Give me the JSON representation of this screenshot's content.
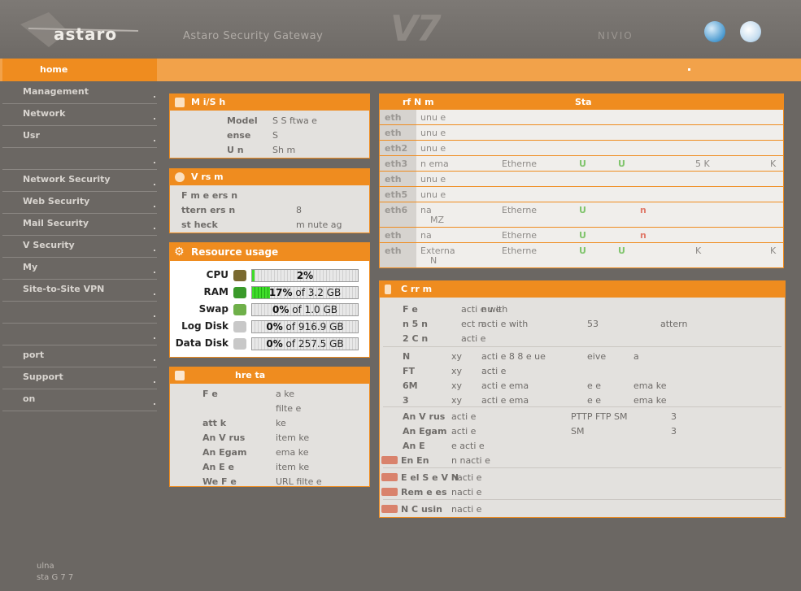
{
  "header": {
    "logo": "astaro",
    "product": "Astaro Security Gateway",
    "version": "V7",
    "user": "NIVIO",
    "icons": [
      "globe-icon",
      "help-icon"
    ]
  },
  "tab": {
    "label": "home"
  },
  "sidebar": {
    "items": [
      {
        "label": "Management"
      },
      {
        "label": "Network"
      },
      {
        "label": "Usr"
      },
      {
        "label": ""
      },
      {
        "label": "Network Security"
      },
      {
        "label": "Web Security"
      },
      {
        "label": "Mail Security"
      },
      {
        "label": "V Security"
      },
      {
        "label": "My"
      },
      {
        "label": "Site-to-Site VPN"
      },
      {
        "label": ""
      },
      {
        "label": ""
      },
      {
        "label": "port"
      },
      {
        "label": "Support"
      },
      {
        "label": "on"
      }
    ],
    "footer_line1": "ulna",
    "footer_line2": "sta G 7 7"
  },
  "system_panel": {
    "title": "M  i/S    h",
    "rows": [
      {
        "label": "Model",
        "value": "S S ftwa e"
      },
      {
        "label": "ense",
        "value": "S"
      },
      {
        "label": "U  n",
        "value": "Sh  m"
      }
    ]
  },
  "version_panel": {
    "title": "V  rs          m",
    "rows": [
      {
        "label": "F m      e  ers  n",
        "value": ""
      },
      {
        "label": "ttern  ers  n",
        "value": "8"
      },
      {
        "label": "st  heck",
        "value": "m nute  ag"
      }
    ]
  },
  "resource_panel": {
    "title": "Resource usage",
    "rows": [
      {
        "label": "CPU",
        "icon": "cpu-icon",
        "value": "2%",
        "extra": "",
        "fraction": 0.02
      },
      {
        "label": "RAM",
        "icon": "ram-icon",
        "value": "17%",
        "extra": "of 3.2 GB",
        "fraction": 0.17
      },
      {
        "label": "Swap",
        "icon": "swap-icon",
        "value": "0%",
        "extra": "of 1.0 GB",
        "fraction": 0.0
      },
      {
        "label": "Log Disk",
        "icon": "disk-icon",
        "value": "0%",
        "extra": "of 916.9 GB",
        "fraction": 0.0
      },
      {
        "label": "Data Disk",
        "icon": "disk-icon",
        "value": "0%",
        "extra": "of 257.5 GB",
        "fraction": 0.0
      }
    ]
  },
  "threat_panel": {
    "title": "hre     ta",
    "rows": [
      {
        "label": "F e",
        "value": "a  ke"
      },
      {
        "label": "",
        "value": "filte e"
      },
      {
        "label": "att  k",
        "value": "ke"
      },
      {
        "label": "An  V rus",
        "value": "item       ke"
      },
      {
        "label": "An  Egam",
        "value": "ema        ke"
      },
      {
        "label": "An  E      e",
        "value": "item       ke"
      },
      {
        "label": "We  F  e",
        "value": "URL  filte e"
      }
    ]
  },
  "interfaces": {
    "headers": [
      "rf  N  m",
      "Sta"
    ],
    "rows": [
      {
        "id": "eth",
        "name": "unu e",
        "type": "",
        "s1": "",
        "s2": "",
        "speed": "",
        "extra": ""
      },
      {
        "id": "eth",
        "name": "unu e",
        "type": "",
        "s1": "",
        "s2": "",
        "speed": "",
        "extra": ""
      },
      {
        "id": "eth2",
        "name": "unu e",
        "type": "",
        "s1": "",
        "s2": "",
        "speed": "",
        "extra": ""
      },
      {
        "id": "eth3",
        "name": "n ema",
        "type": "Etherne",
        "s1": "U",
        "s2": "U",
        "speed": "5 K",
        "extra": "K"
      },
      {
        "id": "eth",
        "name": "unu e",
        "type": "",
        "s1": "",
        "s2": "",
        "speed": "",
        "extra": ""
      },
      {
        "id": "eth5",
        "name": "unu e",
        "type": "",
        "s1": "",
        "s2": "",
        "speed": "",
        "extra": ""
      },
      {
        "id": "eth6",
        "name": "na",
        "name2": "MZ",
        "type": "Etherne",
        "s1": "U",
        "s2": "n",
        "speed": "",
        "extra": ""
      },
      {
        "id": "eth",
        "name": "na",
        "type": "Etherne",
        "s1": "U",
        "s2": "n",
        "speed": "",
        "extra": ""
      },
      {
        "id": "eth",
        "name": "Externa",
        "name2": "N",
        "type": "Etherne",
        "s1": "U",
        "s2": "U",
        "speed": "K",
        "extra": "K"
      }
    ]
  },
  "config_panel": {
    "title": "C  rr          m",
    "rows": [
      {
        "a": "F  e",
        "b": "acti e with",
        "c": "nu e",
        "d": ""
      },
      {
        "a": "n   5   n",
        "b": "ect  n",
        "c": "acti e with",
        "d": "53",
        "e": "attern"
      },
      {
        "a": "2  C  n",
        "b": "acti e",
        "c": "",
        "d": ""
      },
      {
        "a": "N",
        "b": "xy",
        "c": "acti e  8 8  e  ue",
        "d": "eive",
        "e": "a"
      },
      {
        "a": "FT",
        "b": "xy",
        "c": "acti e",
        "d": ""
      },
      {
        "a": "6M",
        "b": "xy",
        "c": "acti e   ema",
        "d": "e   e",
        "e": "ema   ke"
      },
      {
        "a": "3",
        "b": "xy",
        "c": "acti e   ema",
        "d": "e   e",
        "e": "ema   ke"
      },
      {
        "a": "An  V rus",
        "b": "acti e",
        "c": "PTTP FTP SM",
        "d": "3"
      },
      {
        "a": "An  Egam",
        "b": "acti e",
        "c": "SM",
        "d": "3"
      },
      {
        "a": "An  E",
        "b": "e   acti e",
        "c": "",
        "d": ""
      },
      {
        "a": "En    En",
        "b": "n   nacti e",
        "c": "",
        "d": ""
      },
      {
        "a": "E  el S  e V  N",
        "b": "nacti e",
        "c": "",
        "d": ""
      },
      {
        "a": "Rem   e      es",
        "b": "nacti e",
        "c": "",
        "d": ""
      },
      {
        "a": "N   C usin",
        "b": "nacti e",
        "c": "",
        "d": ""
      }
    ]
  }
}
